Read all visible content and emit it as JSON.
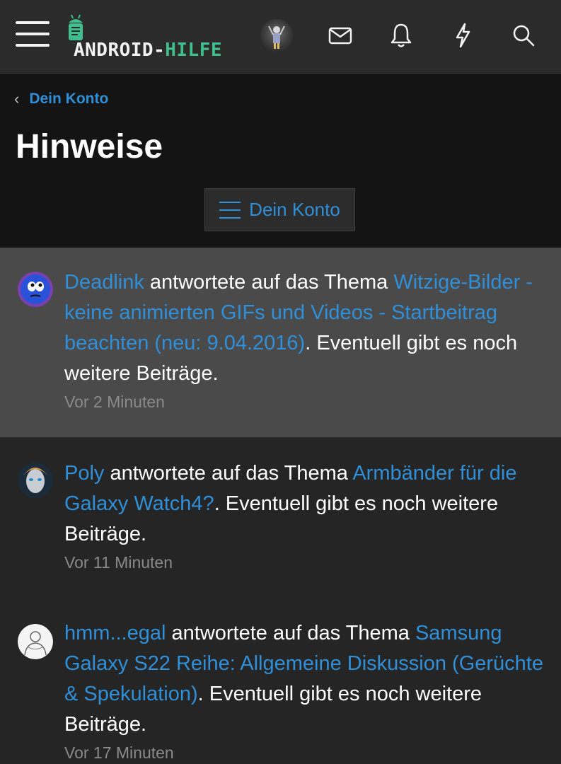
{
  "header": {
    "logo_text_a": "ANDROID-",
    "logo_text_b": "HILFE",
    "icons": [
      "menu-icon",
      "envelope-icon",
      "bell-icon",
      "lightning-icon",
      "search-icon"
    ]
  },
  "breadcrumb": {
    "label": "Dein Konto"
  },
  "page": {
    "title": "Hinweise"
  },
  "account_button": {
    "label": "Dein Konto"
  },
  "alerts": [
    {
      "user": "Deadlink",
      "action": " antwortete auf das Thema ",
      "thread": "Witzige-Bilder - keine animierten GIFs und Videos - Startbeitrag beachten (neu: 9.04.2016)",
      "suffix": ". Eventuell gibt es noch weitere Beiträge.",
      "time": "Vor 2 Minuten",
      "unread": true
    },
    {
      "user": "Poly",
      "action": " antwortete auf das Thema ",
      "thread": "Armbänder für die Galaxy Watch4?",
      "suffix": ". Eventuell gibt es noch weitere Beiträge.",
      "time": "Vor 11 Minuten",
      "unread": false
    },
    {
      "user": "hmm...egal",
      "action": " antwortete auf das Thema ",
      "thread": "Samsung Galaxy S22 Reihe: Allgemeine Diskussion (Gerüchte & Spekulation)",
      "suffix": ". Eventuell gibt es noch weitere Beiträge.",
      "time": "Vor 17 Minuten",
      "unread": false
    }
  ],
  "colors": {
    "link": "#2f8fd8",
    "logo_accent": "#3fbf8f",
    "unread_bg": "#4a4a4a",
    "page_bg": "#252525",
    "header_bg": "#141414"
  }
}
